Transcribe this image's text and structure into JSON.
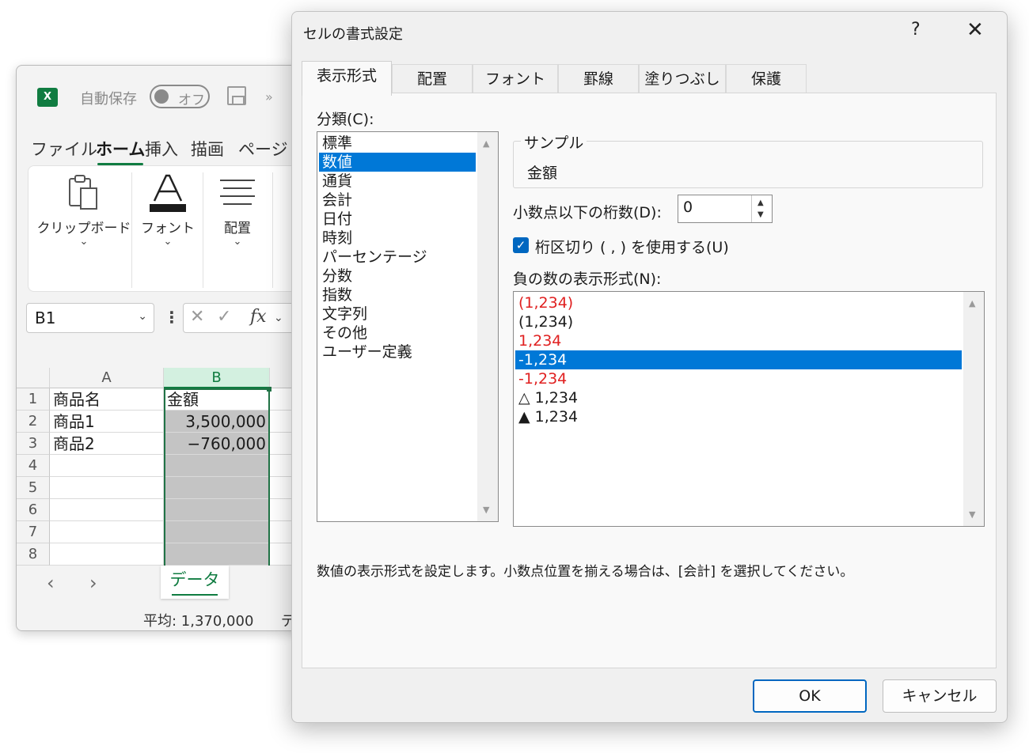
{
  "excel": {
    "logo": "X",
    "autosave_label": "自動保存",
    "toggle_label": "オフ",
    "more": "»",
    "tabs": [
      "ファイル",
      "ホーム",
      "挿入",
      "描画",
      "ページ"
    ],
    "active_tab": "ホーム",
    "ribbon_groups": [
      {
        "label": "クリップボード",
        "icon": "clipboard-icon"
      },
      {
        "label": "フォント",
        "icon": "font-color-icon"
      },
      {
        "label": "配置",
        "icon": "align-icon"
      }
    ],
    "namebox": "B1",
    "formula_fx": "fx",
    "columns": [
      "A",
      "B"
    ],
    "rows": [
      {
        "n": "1",
        "a": "商品名",
        "b": "金額"
      },
      {
        "n": "2",
        "a": "商品1",
        "b": "3,500,000"
      },
      {
        "n": "3",
        "a": "商品2",
        "b": "−760,000"
      },
      {
        "n": "4",
        "a": "",
        "b": ""
      },
      {
        "n": "5",
        "a": "",
        "b": ""
      },
      {
        "n": "6",
        "a": "",
        "b": ""
      },
      {
        "n": "7",
        "a": "",
        "b": ""
      },
      {
        "n": "8",
        "a": "",
        "b": ""
      }
    ],
    "sheet_tab": "データ",
    "status_average": "平均: 1,370,000",
    "status_next": "デ",
    "accent": "#107c41"
  },
  "dialog": {
    "title": "セルの書式設定",
    "help": "?",
    "close": "✕",
    "tabs": [
      "表示形式",
      "配置",
      "フォント",
      "罫線",
      "塗りつぶし",
      "保護"
    ],
    "active_tab": "表示形式",
    "category_label": "分類(C):",
    "categories": [
      "標準",
      "数値",
      "通貨",
      "会計",
      "日付",
      "時刻",
      "パーセンテージ",
      "分数",
      "指数",
      "文字列",
      "その他",
      "ユーザー定義"
    ],
    "selected_category": "数値",
    "sample_label": "サンプル",
    "sample_value": "金額",
    "decimal_label": "小数点以下の桁数(D):",
    "decimal_value": "0",
    "separator_label": "桁区切り ( , ) を使用する(U)",
    "separator_checked": true,
    "negative_label": "負の数の表示形式(N):",
    "negative_formats": [
      {
        "text": "(1,234)",
        "red": true
      },
      {
        "text": "(1,234)",
        "red": false
      },
      {
        "text": "1,234",
        "red": true
      },
      {
        "text": "-1,234",
        "red": false,
        "selected": true
      },
      {
        "text": "-1,234",
        "red": true
      },
      {
        "text": "△ 1,234",
        "red": false
      },
      {
        "text": "▲ 1,234",
        "red": false
      }
    ],
    "description": "数値の表示形式を設定します。小数点位置を揃える場合は、[会計] を選択してください。",
    "ok_label": "OK",
    "cancel_label": "キャンセル",
    "selection_color": "#0078d7",
    "negative_red": "#e02020"
  }
}
